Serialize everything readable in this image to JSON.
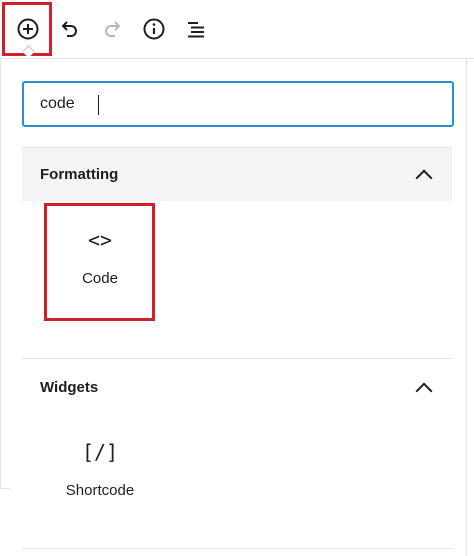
{
  "toolbar": {
    "add_icon": "plus-circle-icon",
    "undo_icon": "undo-icon",
    "redo_icon": "redo-icon",
    "info_icon": "info-icon",
    "outline_icon": "list-outline-icon"
  },
  "search": {
    "value": "code"
  },
  "sections": [
    {
      "title": "Formatting",
      "items": [
        {
          "icon_glyph": "<>",
          "label": "Code"
        }
      ]
    },
    {
      "title": "Widgets",
      "items": [
        {
          "icon_glyph": "[/]",
          "label": "Shortcode"
        }
      ]
    }
  ],
  "colors": {
    "highlight": "#d11f2c",
    "focus": "#2c8fd1",
    "section_bg": "#f3f4f5"
  }
}
